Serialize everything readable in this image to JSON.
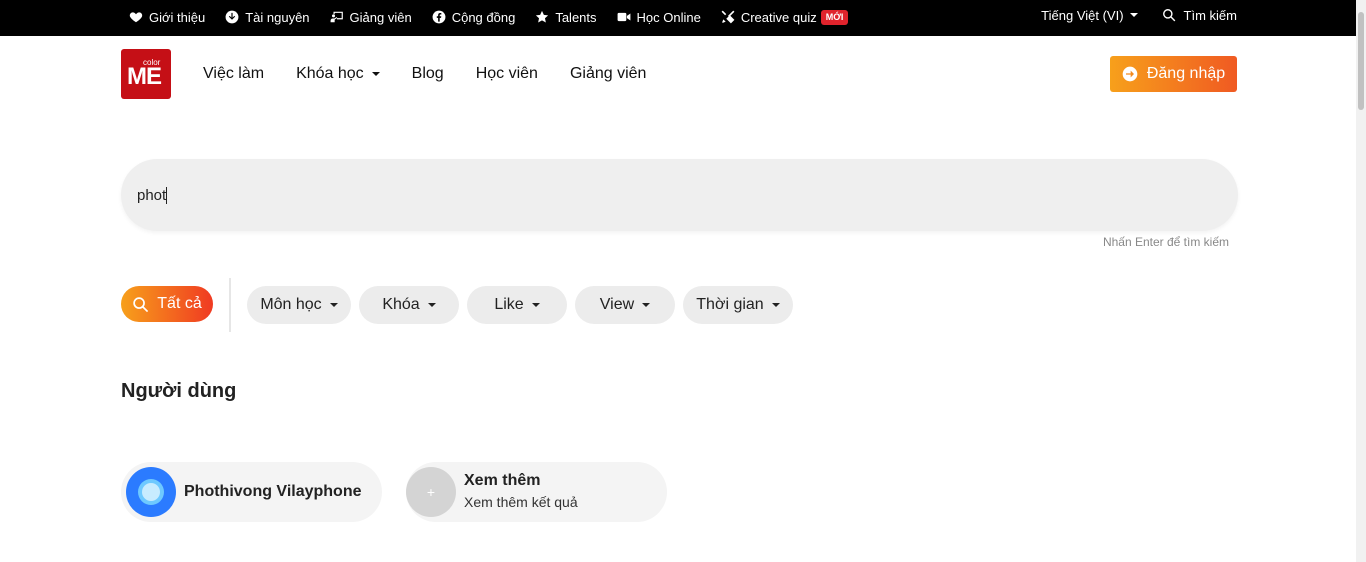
{
  "topbar": {
    "links": [
      {
        "label": "Giới thiệu",
        "icon": "heart-icon"
      },
      {
        "label": "Tài nguyên",
        "icon": "download-icon"
      },
      {
        "label": "Giảng viên",
        "icon": "teacher-icon"
      },
      {
        "label": "Cộng đồng",
        "icon": "facebook-icon"
      },
      {
        "label": "Talents",
        "icon": "star-icon"
      },
      {
        "label": "Học Online",
        "icon": "video-icon"
      },
      {
        "label": "Creative quiz",
        "icon": "tools-icon",
        "badge": "MỚI"
      }
    ],
    "language": "Tiếng Việt (VI)",
    "search_label": "Tìm kiếm"
  },
  "header": {
    "logo_small": "color",
    "logo_big": "ME",
    "nav": [
      {
        "label": "Việc làm"
      },
      {
        "label": "Khóa học",
        "dropdown": true
      },
      {
        "label": "Blog"
      },
      {
        "label": "Học viên"
      },
      {
        "label": "Giảng viên"
      }
    ],
    "login_label": "Đăng nhập"
  },
  "search": {
    "value": "phot",
    "hint": "Nhấn Enter để tìm kiếm"
  },
  "filters": {
    "all_label": "Tất cả",
    "chips": [
      "Môn học",
      "Khóa",
      "Like",
      "View",
      "Thời gian"
    ]
  },
  "users": {
    "title": "Người dùng",
    "results": [
      {
        "name": "Phothivong Vilayphone"
      }
    ],
    "more": {
      "icon_text": "+",
      "title": "Xem thêm",
      "subtitle": "Xem thêm kết quả"
    }
  },
  "colors": {
    "topbar_bg": "#000000",
    "brand_red": "#c50f16",
    "accent_orange_start": "#f7a01b",
    "accent_orange_end": "#f05a22",
    "badge_red": "#e0232c"
  }
}
